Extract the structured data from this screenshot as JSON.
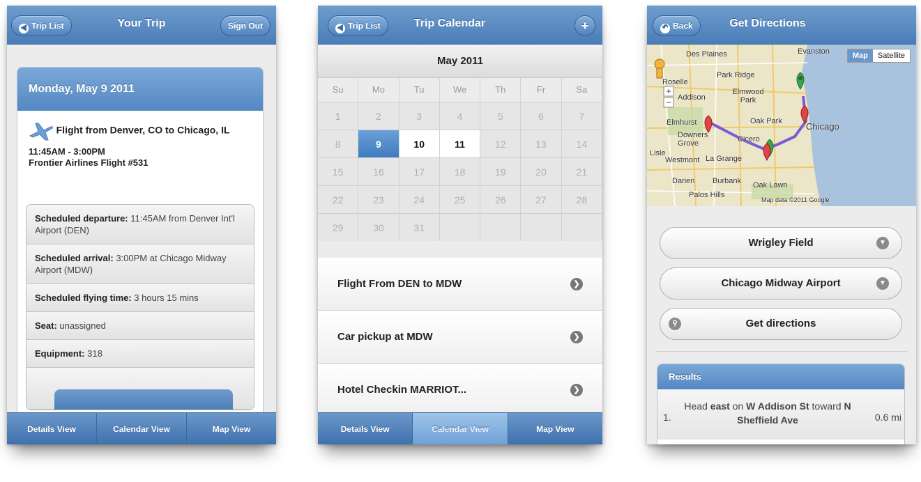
{
  "screen1": {
    "header": {
      "back": "Trip List",
      "title": "Your Trip",
      "action": "Sign Out"
    },
    "card": {
      "date": "Monday, May 9 2011",
      "flight_title": "Flight from Denver, CO to Chicago, IL",
      "time": "11:45AM - 3:00PM",
      "carrier": "Frontier Airlines Flight #531"
    },
    "details": [
      {
        "label": "Scheduled departure:",
        "value": " 11:45AM from Denver Int'l Airport (DEN)"
      },
      {
        "label": "Scheduled arrival:",
        "value": " 3:00PM at Chicago Midway Airport (MDW)"
      },
      {
        "label": "Scheduled flying time:",
        "value": " 3 hours 15 mins"
      },
      {
        "label": "Seat:",
        "value": " unassigned"
      },
      {
        "label": "Equipment:",
        "value": " 318"
      }
    ],
    "tabs": [
      "Details View",
      "Calendar View",
      "Map View"
    ]
  },
  "screen2": {
    "header": {
      "back": "Trip List",
      "title": "Trip Calendar"
    },
    "month": "May 2011",
    "weekdays": [
      "Su",
      "Mo",
      "Tu",
      "We",
      "Th",
      "Fr",
      "Sa"
    ],
    "weeks": [
      [
        "1",
        "2",
        "3",
        "4",
        "5",
        "6",
        "7"
      ],
      [
        "8",
        "9",
        "10",
        "11",
        "12",
        "13",
        "14"
      ],
      [
        "15",
        "16",
        "17",
        "18",
        "19",
        "20",
        "21"
      ],
      [
        "22",
        "23",
        "24",
        "25",
        "26",
        "27",
        "28"
      ],
      [
        "29",
        "30",
        "31",
        "",
        "",
        "",
        ""
      ]
    ],
    "selected_day": "9",
    "highlighted_days": [
      "10",
      "11"
    ],
    "events": [
      "Flight From DEN to MDW",
      "Car pickup at MDW",
      "Hotel Checkin MARRIOT..."
    ],
    "tabs": [
      "Details View",
      "Calendar View",
      "Map View"
    ],
    "active_tab": "Calendar View"
  },
  "screen3": {
    "header": {
      "back": "Back",
      "title": "Get Directions"
    },
    "map": {
      "buttons": [
        "Map",
        "Satellite"
      ],
      "labels": [
        "Des Plaines",
        "Evanston",
        "Park Ridge",
        "Roselle",
        "Addison",
        "Elmwood Park",
        "Oak Park",
        "Chicago",
        "Elmhurst",
        "Downers Grove",
        "Cicero",
        "Westmont",
        "La Grange",
        "Darien",
        "Burbank",
        "Oak Lawn",
        "Palos Hills",
        "Lisle"
      ],
      "copyright": "Map data ©2011 Google"
    },
    "origin": "Wrigley Field",
    "destination": "Chicago Midway Airport",
    "go_label": "Get directions",
    "results": {
      "title": "Results",
      "steps": [
        {
          "num": "1.",
          "pre": "Head ",
          "b1": "east",
          "mid": " on ",
          "b2": "W Addison St",
          "mid2": " toward ",
          "b3": "N Sheffield Ave",
          "dist": "0.6 mi"
        }
      ]
    }
  },
  "colors": {
    "header_blue": "#5a8cc5",
    "selected_day": "#4a85c4"
  }
}
